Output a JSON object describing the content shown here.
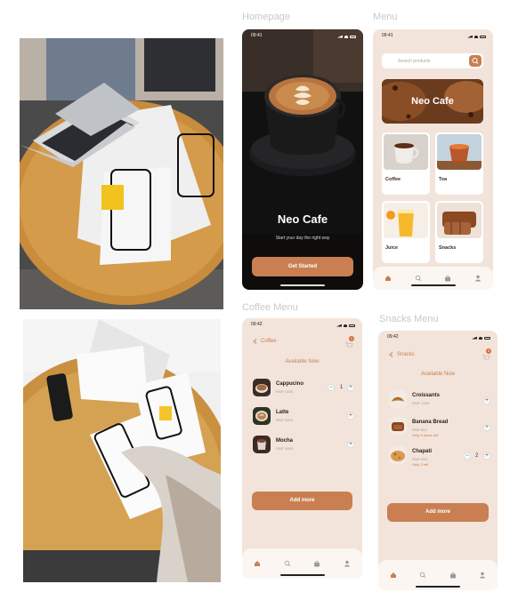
{
  "labels": {
    "homepage": "Homepage",
    "menu": "Menu",
    "coffee_menu": "Coffee Menu",
    "snacks_menu": "Snacks Menu"
  },
  "colors": {
    "accent": "#c97f51",
    "bg": "#f2e4da",
    "dark": "#141210"
  },
  "homepage": {
    "time": "09:41",
    "title": "Neo Cafe",
    "subtitle": "Start your day the right way",
    "button": "Get Started"
  },
  "menu": {
    "time": "09:41",
    "search_placeholder": "Search products",
    "banner": "Neo Cafe",
    "tiles": [
      {
        "name": "Coffee"
      },
      {
        "name": "Tea"
      },
      {
        "name": "Juice"
      },
      {
        "name": "Snacks"
      }
    ],
    "nav": [
      "home-icon",
      "search-icon",
      "bag-icon",
      "user-icon"
    ]
  },
  "coffee_menu": {
    "time": "09:42",
    "back": "Coffee",
    "cart_badge": "1",
    "heading": "Available Now",
    "items": [
      {
        "name": "Cappucino",
        "price": "RWF 2000",
        "qty": "1"
      },
      {
        "name": "Latte",
        "price": "RWF 2500"
      },
      {
        "name": "Mocha",
        "price": "RWF 3000"
      }
    ],
    "button": "Add more"
  },
  "snacks_menu": {
    "time": "09:42",
    "back": "Snacks",
    "cart_badge": "3",
    "heading": "Available Now",
    "items": [
      {
        "name": "Croissants",
        "price": "RWF 1000",
        "note": ""
      },
      {
        "name": "Banana Bread",
        "price": "RWF 800",
        "note": "Only 4 slices left"
      },
      {
        "name": "Chapati",
        "price": "RWF 500",
        "note": "Only 2 left",
        "qty": "2"
      }
    ],
    "button": "Add more"
  }
}
